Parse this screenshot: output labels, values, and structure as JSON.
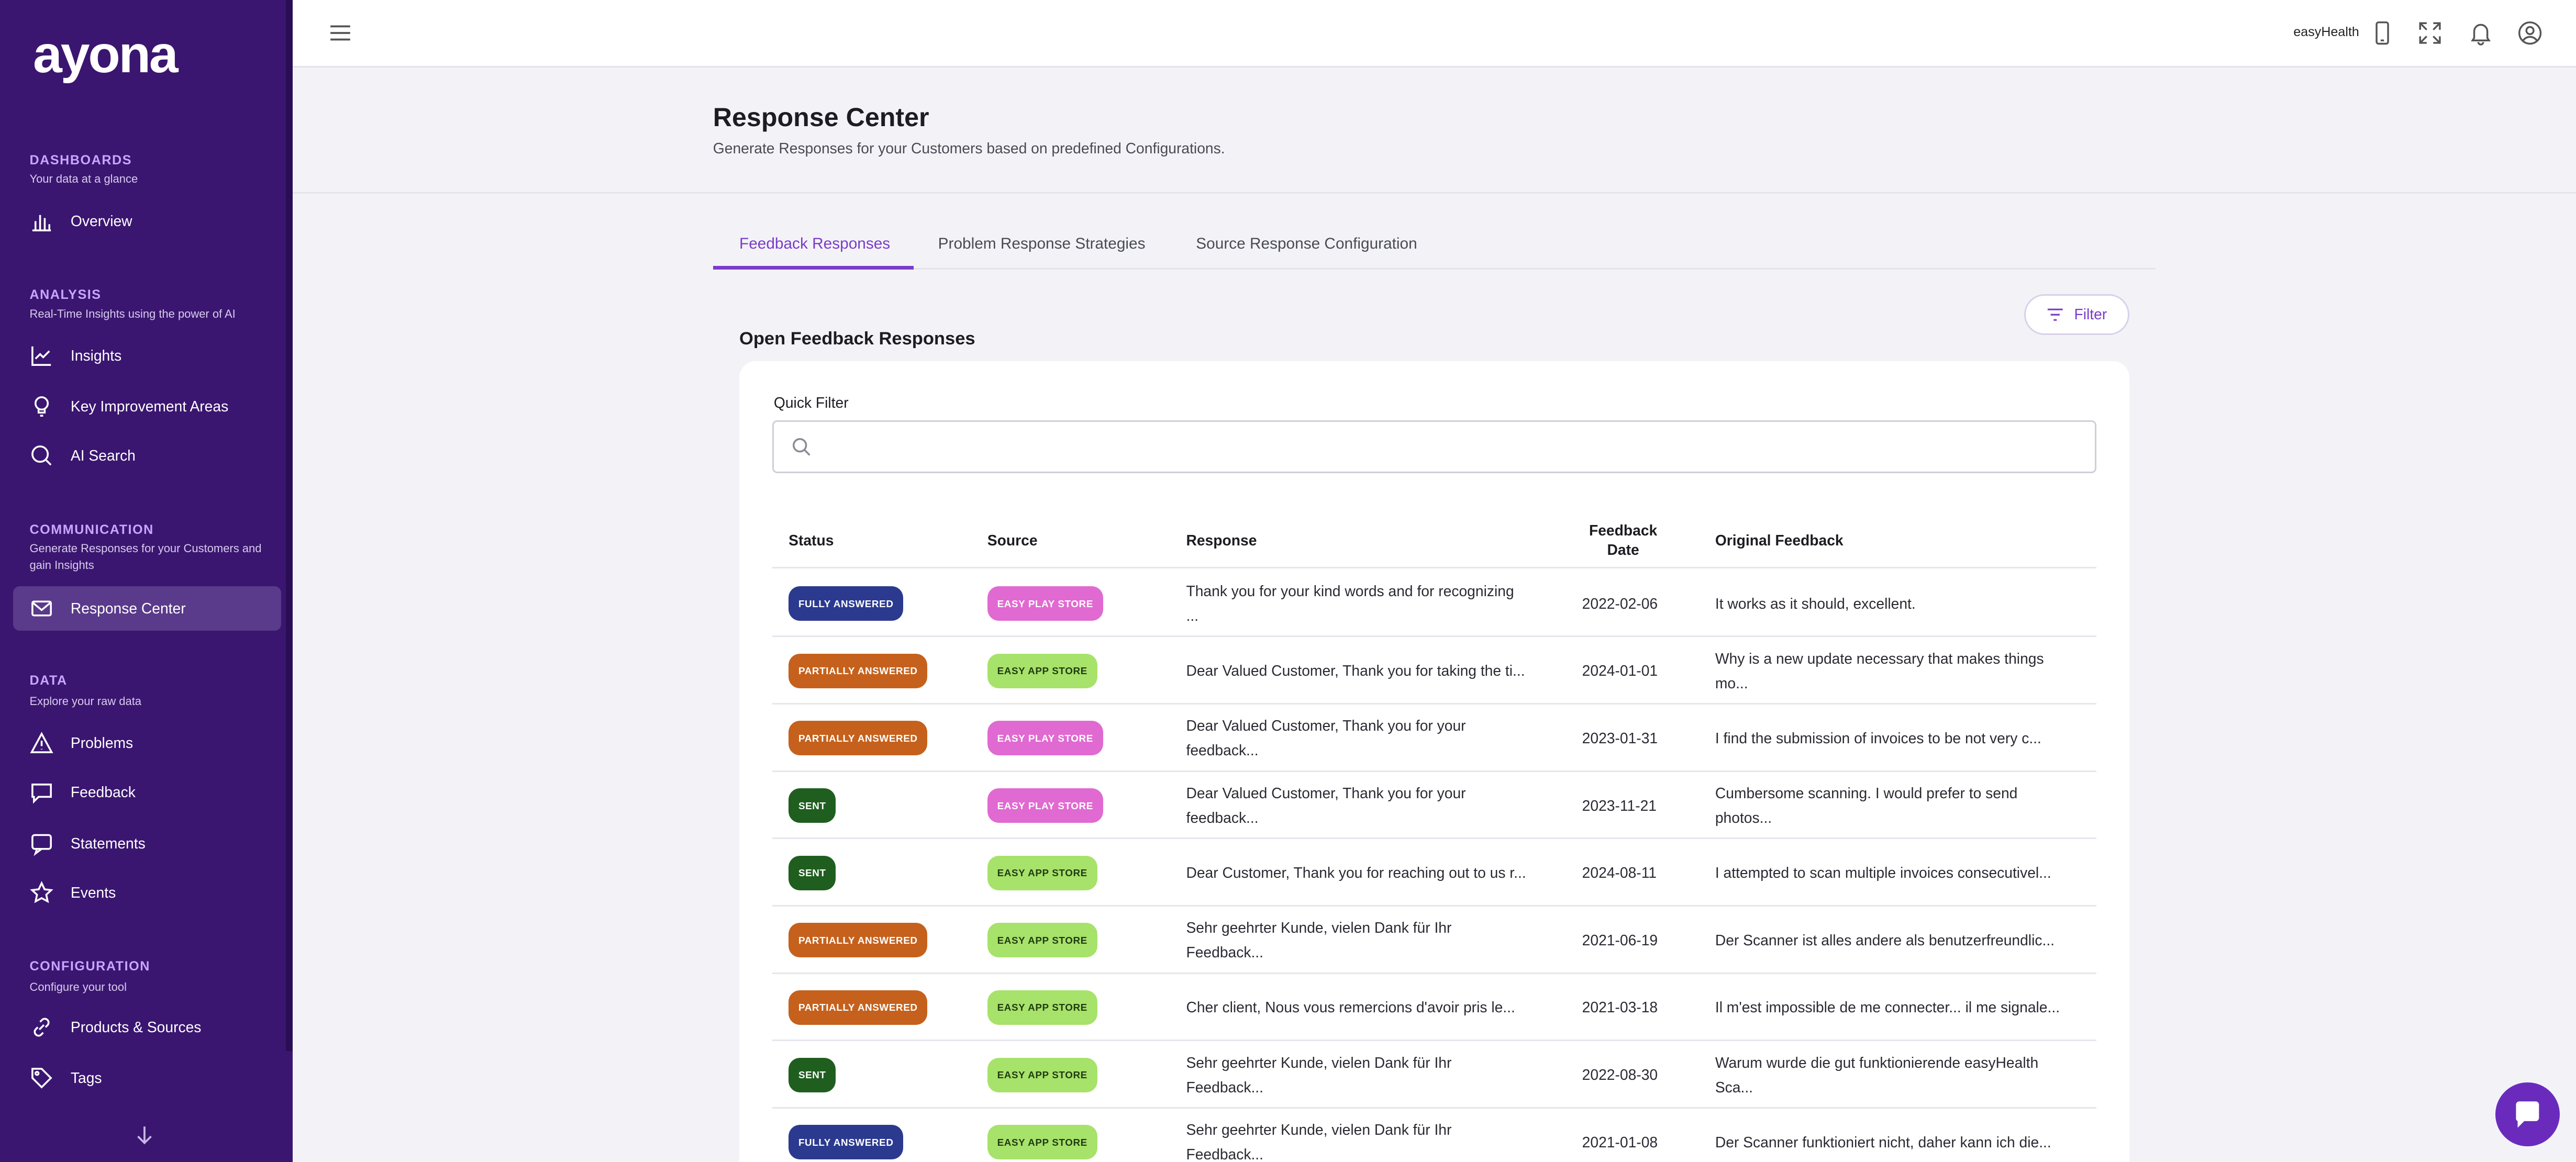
{
  "app": {
    "logo_text": "ayona",
    "brand": "easyHealth"
  },
  "sidebar": {
    "sections": [
      {
        "title": "DASHBOARDS",
        "subtitle": "Your data at a glance"
      },
      {
        "title": "ANALYSIS",
        "subtitle": "Real-Time Insights using the power of AI"
      },
      {
        "title": "COMMUNICATION",
        "subtitle": "Generate Responses for your Customers and gain Insights"
      },
      {
        "title": "DATA",
        "subtitle": "Explore your raw data"
      },
      {
        "title": "CONFIGURATION",
        "subtitle": "Configure your tool"
      }
    ],
    "items": [
      {
        "label": "Overview",
        "icon": "bar-chart-icon"
      },
      {
        "label": "Insights",
        "icon": "insights-chart-icon"
      },
      {
        "label": "Key Improvement Areas",
        "icon": "lightbulb-icon"
      },
      {
        "label": "AI Search",
        "icon": "search-icon"
      },
      {
        "label": "Response Center",
        "icon": "mail-icon",
        "active": true
      },
      {
        "label": "Problems",
        "icon": "warning-icon"
      },
      {
        "label": "Feedback",
        "icon": "chat-icon"
      },
      {
        "label": "Statements",
        "icon": "message-square-icon"
      },
      {
        "label": "Events",
        "icon": "star-icon"
      },
      {
        "label": "Products & Sources",
        "icon": "link-icon"
      },
      {
        "label": "Tags",
        "icon": "tag-icon"
      }
    ]
  },
  "header": {
    "title": "Response Center",
    "subtitle": "Generate Responses for your Customers based on predefined Configurations."
  },
  "tabs": [
    {
      "label": "Feedback Responses",
      "active": true
    },
    {
      "label": "Problem Response Strategies"
    },
    {
      "label": "Source Response Configuration"
    }
  ],
  "filter_button": "Filter",
  "section_heading": "Open Feedback Responses",
  "quick_filter": {
    "label": "Quick Filter",
    "value": "",
    "placeholder": ""
  },
  "table": {
    "headers": {
      "status": "Status",
      "source": "Source",
      "response": "Response",
      "feedback_date_line1": "Feedback",
      "feedback_date_line2": "Date",
      "original_feedback": "Original Feedback"
    },
    "rows": [
      {
        "status": "FULLY ANSWERED",
        "status_color": "#2b3a8f",
        "source": "EASY PLAY STORE",
        "source_bg": "#e06ad1",
        "source_fg": "#ffffff",
        "response_l1": "Thank you for your kind words and for recognizing",
        "response_l2": "...",
        "date": "2022-02-06",
        "feedback_l1": "It works as it should, excellent.",
        "feedback_l2": ""
      },
      {
        "status": "PARTIALLY ANSWERED",
        "status_color": "#c5611c",
        "source": "EASY APP STORE",
        "source_bg": "#a7e26a",
        "source_fg": "#1f3a10",
        "response_l1": "Dear Valued Customer, Thank you for taking the ti...",
        "response_l2": "",
        "date": "2024-01-01",
        "feedback_l1": "Why is a new update necessary that makes things",
        "feedback_l2": "mo..."
      },
      {
        "status": "PARTIALLY ANSWERED",
        "status_color": "#c5611c",
        "source": "EASY PLAY STORE",
        "source_bg": "#e06ad1",
        "source_fg": "#ffffff",
        "response_l1": "Dear Valued Customer, Thank you for your",
        "response_l2": "feedback...",
        "date": "2023-01-31",
        "feedback_l1": "I find the submission of invoices to be not very c...",
        "feedback_l2": ""
      },
      {
        "status": "SENT",
        "status_color": "#1f5e1f",
        "source": "EASY PLAY STORE",
        "source_bg": "#e06ad1",
        "source_fg": "#ffffff",
        "response_l1": "Dear Valued Customer, Thank you for your",
        "response_l2": "feedback...",
        "date": "2023-11-21",
        "feedback_l1": "Cumbersome scanning. I would prefer to send",
        "feedback_l2": "photos..."
      },
      {
        "status": "SENT",
        "status_color": "#1f5e1f",
        "source": "EASY APP STORE",
        "source_bg": "#a7e26a",
        "source_fg": "#1f3a10",
        "response_l1": "Dear Customer, Thank you for reaching out to us r...",
        "response_l2": "",
        "date": "2024-08-11",
        "feedback_l1": "I attempted to scan multiple invoices consecutivel...",
        "feedback_l2": ""
      },
      {
        "status": "PARTIALLY ANSWERED",
        "status_color": "#c5611c",
        "source": "EASY APP STORE",
        "source_bg": "#a7e26a",
        "source_fg": "#1f3a10",
        "response_l1": "Sehr geehrter Kunde, vielen Dank für Ihr",
        "response_l2": "Feedback...",
        "date": "2021-06-19",
        "feedback_l1": "Der Scanner ist alles andere als benutzerfreundlic...",
        "feedback_l2": ""
      },
      {
        "status": "PARTIALLY ANSWERED",
        "status_color": "#c5611c",
        "source": "EASY APP STORE",
        "source_bg": "#a7e26a",
        "source_fg": "#1f3a10",
        "response_l1": "Cher client, Nous vous remercions d'avoir pris le...",
        "response_l2": "",
        "date": "2021-03-18",
        "feedback_l1": "Il m'est impossible de me connecter... il me signale...",
        "feedback_l2": ""
      },
      {
        "status": "SENT",
        "status_color": "#1f5e1f",
        "source": "EASY APP STORE",
        "source_bg": "#a7e26a",
        "source_fg": "#1f3a10",
        "response_l1": "Sehr geehrter Kunde, vielen Dank für Ihr",
        "response_l2": "Feedback...",
        "date": "2022-08-30",
        "feedback_l1": "Warum wurde die gut funktionierende easyHealth",
        "feedback_l2": "Sca..."
      },
      {
        "status": "FULLY ANSWERED",
        "status_color": "#2b3a8f",
        "source": "EASY APP STORE",
        "source_bg": "#a7e26a",
        "source_fg": "#1f3a10",
        "response_l1": "Sehr geehrter Kunde, vielen Dank für Ihr",
        "response_l2": "Feedback...",
        "date": "2021-01-08",
        "feedback_l1": "Der Scanner funktioniert nicht, daher kann ich die...",
        "feedback_l2": ""
      }
    ]
  },
  "top_icons": [
    "phone-icon",
    "fullscreen-icon",
    "bell-icon",
    "user-circle-icon"
  ],
  "colors": {
    "sidebar_bg": "#3a1670",
    "accent": "#7a3cc9",
    "chat_bubble": "#6a2bbd"
  }
}
